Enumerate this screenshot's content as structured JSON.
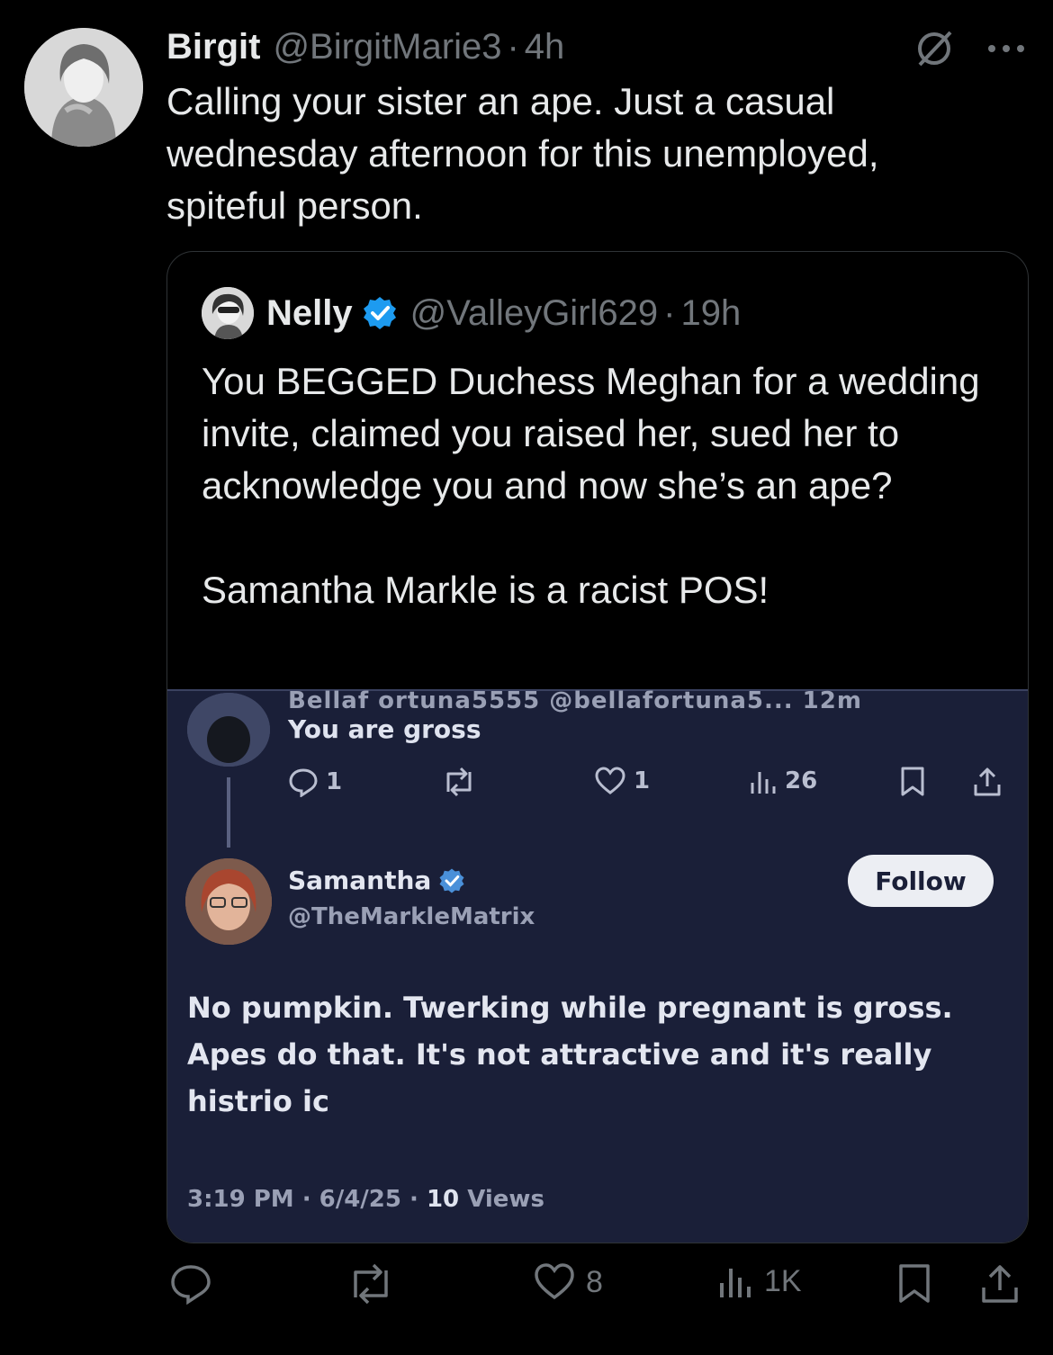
{
  "tweet": {
    "author_name": "Birgit",
    "author_handle": "@BirgitMarie3",
    "separator": "·",
    "time": "4h",
    "text": "Calling your sister an ape. Just a casual wednesday afternoon for this unemployed, spiteful person.",
    "icons": [
      "grok-icon",
      "more-icon"
    ]
  },
  "quote": {
    "author_name": "Nelly",
    "author_handle": "@ValleyGirl629",
    "separator": "·",
    "time": "19h",
    "text_p1": "You BEGGED Duchess Meghan for a wedding invite, claimed you raised her, sued her to acknowledge you and now she’s an ape?",
    "text_p2": "Samantha Markle is a racist POS!"
  },
  "screenshot": {
    "cut_header": "Bellaf ortuna5555 @bellafortuna5... 12m",
    "reply_text": "You are gross",
    "reply_counts": {
      "replies": "1",
      "likes": "1",
      "views": "26"
    },
    "author_name": "Samantha",
    "author_handle": "@TheMarkleMatrix",
    "follow_label": "Follow",
    "body": "No pumpkin. Twerking while pregnant is gross. Apes do that. It's not attractive and it's really histrio ic",
    "meta_time": "3:19 PM · 6/4/25 · ",
    "meta_views_count": "10",
    "meta_views_label": " Views"
  },
  "actions": {
    "likes": "8",
    "views": "1K"
  },
  "colors": {
    "background": "#000000",
    "text": "#e7e9ea",
    "muted": "#71767b",
    "verified": "#1d9bf0",
    "screenshot_bg": "#1a1f38"
  }
}
